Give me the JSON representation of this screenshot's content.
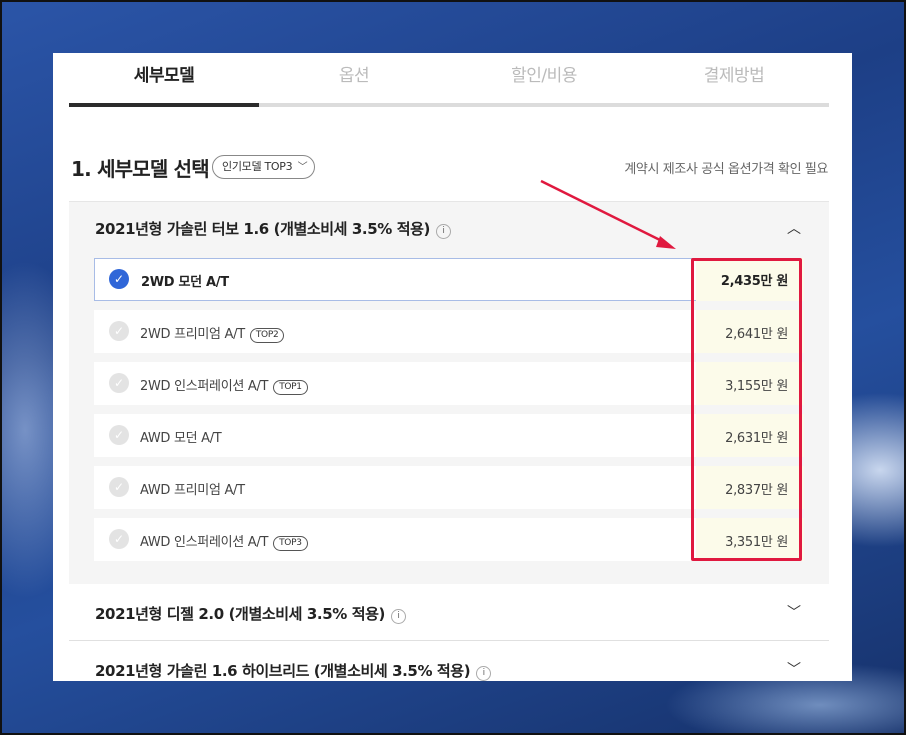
{
  "tabs": [
    {
      "label": "세부모델",
      "active": true
    },
    {
      "label": "옵션",
      "active": false
    },
    {
      "label": "할인/비용",
      "active": false
    },
    {
      "label": "결제방법",
      "active": false
    }
  ],
  "section": {
    "title": "1. 세부모델 선택",
    "popular_button": "인기모델 TOP3",
    "notice": "계약시 제조사 공식 옵션가격 확인 필요"
  },
  "groups": [
    {
      "title": "2021년형 가솔린 터보 1.6 (개별소비세 3.5% 적용)",
      "expanded": true,
      "models": [
        {
          "name": "2WD 모던 A/T",
          "badge": "",
          "price": "2,435",
          "unit": "만 원",
          "selected": true
        },
        {
          "name": "2WD 프리미엄 A/T",
          "badge": "TOP2",
          "price": "2,641",
          "unit": "만 원",
          "selected": false
        },
        {
          "name": "2WD 인스퍼레이션 A/T",
          "badge": "TOP1",
          "price": "3,155",
          "unit": "만 원",
          "selected": false
        },
        {
          "name": "AWD 모던 A/T",
          "badge": "",
          "price": "2,631",
          "unit": "만 원",
          "selected": false
        },
        {
          "name": "AWD 프리미엄 A/T",
          "badge": "",
          "price": "2,837",
          "unit": "만 원",
          "selected": false
        },
        {
          "name": "AWD 인스퍼레이션 A/T",
          "badge": "TOP3",
          "price": "3,351",
          "unit": "만 원",
          "selected": false
        }
      ]
    },
    {
      "title": "2021년형 디젤 2.0 (개별소비세 3.5% 적용)",
      "expanded": false
    },
    {
      "title": "2021년형 가솔린 1.6 하이브리드 (개별소비세 3.5% 적용)",
      "expanded": false
    }
  ],
  "colors": {
    "accent": "#2f66d8",
    "annotation": "#e0193f",
    "price_bg": "#fcfbea"
  },
  "icons": {
    "info": "i",
    "check": "✓",
    "chevron_up": "︿",
    "chevron_down": "﹀"
  }
}
